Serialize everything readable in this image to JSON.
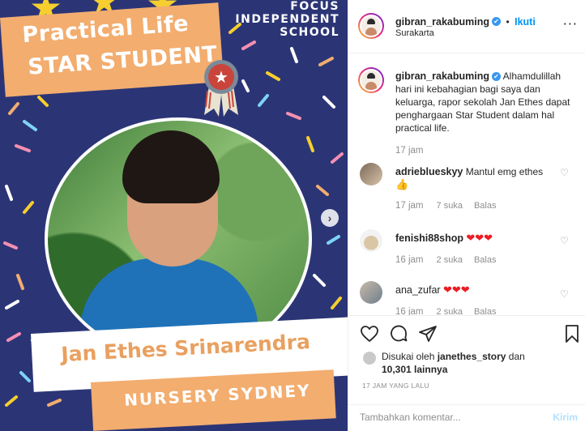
{
  "post_image": {
    "school_line1": "FOCUS",
    "school_line2": "INDEPENDENT",
    "school_line3": "SCHOOL",
    "award_line1": "Practical Life",
    "award_line2": "STAR STUDENT",
    "student_name": "Jan Ethes Srinarendra",
    "class_name": "NURSERY SYDNEY",
    "next_arrow": "›",
    "colors": {
      "background": "#2b3576",
      "accent": "#f2ad6f",
      "star": "#f6cf2e"
    }
  },
  "header": {
    "username": "gibran_rakabuming",
    "verified_icon": "✔",
    "separator": "•",
    "follow_label": "Ikuti",
    "location": "Surakarta",
    "more_icon": "···"
  },
  "caption": {
    "username": "gibran_rakabuming",
    "text": "Alhamdulillah hari ini kebahagian bagi saya dan keluarga, rapor sekolah Jan Ethes dapat penghargaan Star Student dalam hal practical life.",
    "time": "17 jam"
  },
  "comments": [
    {
      "username": "adrieblueskyy",
      "text": "Mantul emg ethes",
      "emoji": "👍",
      "time": "17 jam",
      "likes": "7 suka",
      "reply": "Balas"
    },
    {
      "username": "fenishi88shop",
      "text": "",
      "emoji": "❤❤❤",
      "time": "16 jam",
      "likes": "2 suka",
      "reply": "Balas"
    },
    {
      "username": "ana_zufar",
      "text": "",
      "emoji": "❤❤❤",
      "time": "16 jam",
      "likes": "2 suka",
      "reply": "Balas"
    }
  ],
  "actions": {
    "liked_prefix": "Disukai oleh",
    "liked_by": "janethes_story",
    "liked_and": "dan",
    "others_count": "10,301 lainnya",
    "time_ago": "17 JAM YANG LALU"
  },
  "add_comment": {
    "placeholder": "Tambahkan komentar...",
    "post_label": "Kirim"
  }
}
